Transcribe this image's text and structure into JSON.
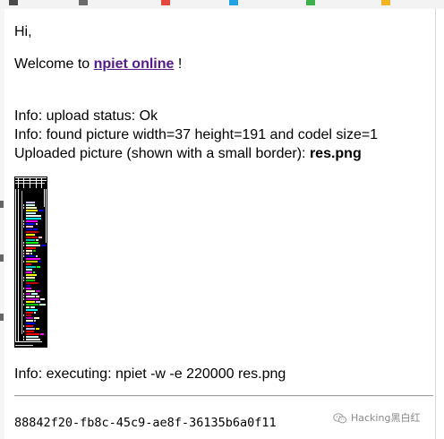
{
  "greeting": "Hi,",
  "welcome": {
    "prefix": "Welcome to ",
    "link_text": "npiet online",
    "suffix": " !"
  },
  "info_upload": "Info: upload status: Ok",
  "info_found": "Info: found picture width=37 height=191 and codel size=1",
  "uploaded": {
    "text": "Uploaded picture (shown with a small border): ",
    "filename": "res.png"
  },
  "picture": {
    "width": 37,
    "height": 191
  },
  "info_executing": "Info: executing: npiet -w -e 220000 res.png",
  "output": "88842f20-fb8c-45c9-ae8f-36135b6a0f11",
  "watermark": {
    "text": "Hacking黑白红",
    "icon": "wechat-icon"
  },
  "colors": {
    "link": "#551a8b",
    "text": "#000000",
    "background": "#ffffff"
  }
}
